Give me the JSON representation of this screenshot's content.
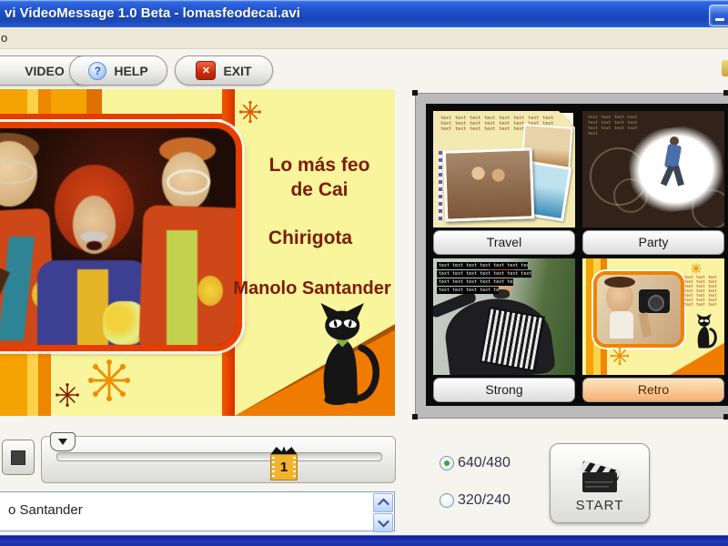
{
  "window": {
    "title": "vi VideoMessage 1.0 Beta - lomasfeodecai.avi"
  },
  "menu": {
    "partial_item": "o"
  },
  "toolbar": {
    "video_label": "VIDEO",
    "help_label": "HELP",
    "help_icon": "?",
    "exit_label": "EXIT",
    "exit_icon": "✕"
  },
  "preview": {
    "line1": "Lo más feo",
    "line2": "de Cai",
    "line3": "Chirigota",
    "line4": "Manolo Santander"
  },
  "templates": {
    "items": [
      {
        "label": "Travel",
        "placeholder": "text text text text text text text text text text text text text text text text text text text text text text text text"
      },
      {
        "label": "Party",
        "placeholder": "text text text text text text text text text text text text text"
      },
      {
        "label": "Strong",
        "lines": [
          "text text text text text text text",
          "text text text text text text text",
          "text text text text text text",
          "text text text text text"
        ]
      },
      {
        "label": "Retro",
        "selected": true,
        "placeholder": "text text text text text text text text text text text text text text text text text text text text text"
      }
    ]
  },
  "player": {
    "frame_number": "1"
  },
  "caption": {
    "value": "o Santander"
  },
  "output": {
    "resolutions": [
      {
        "label": "640/480",
        "selected": true
      },
      {
        "label": "320/240",
        "selected": false
      }
    ],
    "start_label": "START"
  },
  "colors": {
    "titlebar_blue": "#1d4ec6",
    "accent_orange": "#ef7c00",
    "preview_yellow": "#f8f59c",
    "frame_red": "#e63d00",
    "selected_label_peach": "#f5b172",
    "bottombar_navy": "#0b1a86"
  }
}
